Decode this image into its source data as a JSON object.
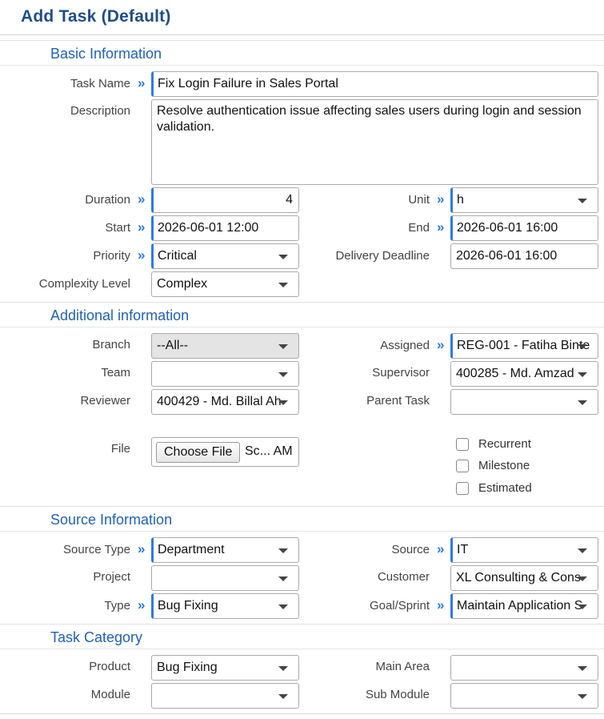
{
  "header": {
    "title": "Add Task (Default)"
  },
  "sections": {
    "basic": "Basic Information",
    "additional": "Additional information",
    "source": "Source Information",
    "category": "Task Category"
  },
  "basic": {
    "task_name": {
      "label": "Task Name",
      "value": "Fix Login Failure in Sales Portal"
    },
    "description": {
      "label": "Description",
      "value": "Resolve authentication issue affecting sales users during login and session validation."
    },
    "duration": {
      "label": "Duration",
      "value": "4"
    },
    "unit": {
      "label": "Unit",
      "value": "h"
    },
    "start": {
      "label": "Start",
      "value": "2026-06-01 12:00"
    },
    "end": {
      "label": "End",
      "value": "2026-06-01 16:00"
    },
    "priority": {
      "label": "Priority",
      "value": "Critical"
    },
    "delivery_deadline": {
      "label": "Delivery Deadline",
      "value": "2026-06-01 16:00"
    },
    "complexity": {
      "label": "Complexity Level",
      "value": "Complex"
    }
  },
  "additional": {
    "branch": {
      "label": "Branch",
      "value": "--All--"
    },
    "assigned": {
      "label": "Assigned",
      "value": "REG-001 - Fatiha Binte"
    },
    "team": {
      "label": "Team",
      "value": ""
    },
    "supervisor": {
      "label": "Supervisor",
      "value": "400285 - Md. Amzad"
    },
    "reviewer": {
      "label": "Reviewer",
      "value": "400429 - Md. Billal Ah"
    },
    "parent_task": {
      "label": "Parent Task",
      "value": ""
    },
    "file": {
      "label": "File",
      "button": "Choose File",
      "filename": "Sc... AM"
    },
    "recurrent": "Recurrent",
    "milestone": "Milestone",
    "estimated": "Estimated"
  },
  "source": {
    "source_type": {
      "label": "Source Type",
      "value": "Department"
    },
    "source": {
      "label": "Source",
      "value": "IT"
    },
    "project": {
      "label": "Project",
      "value": ""
    },
    "customer": {
      "label": "Customer",
      "value": "XL Consulting & Cons"
    },
    "type": {
      "label": "Type",
      "value": "Bug Fixing"
    },
    "goal": {
      "label": "Goal/Sprint",
      "value": "Maintain Application S"
    }
  },
  "category": {
    "product": {
      "label": "Product",
      "value": "Bug Fixing"
    },
    "main_area": {
      "label": "Main Area",
      "value": ""
    },
    "module": {
      "label": "Module",
      "value": ""
    },
    "sub_module": {
      "label": "Sub Module",
      "value": ""
    }
  },
  "icons": {
    "required": "double-chevron-right-icon",
    "dropdown": "caret-down-icon"
  },
  "colors": {
    "title": "#1f4e8c",
    "section": "#1f62b8",
    "required_accent": "#2c7be5"
  }
}
